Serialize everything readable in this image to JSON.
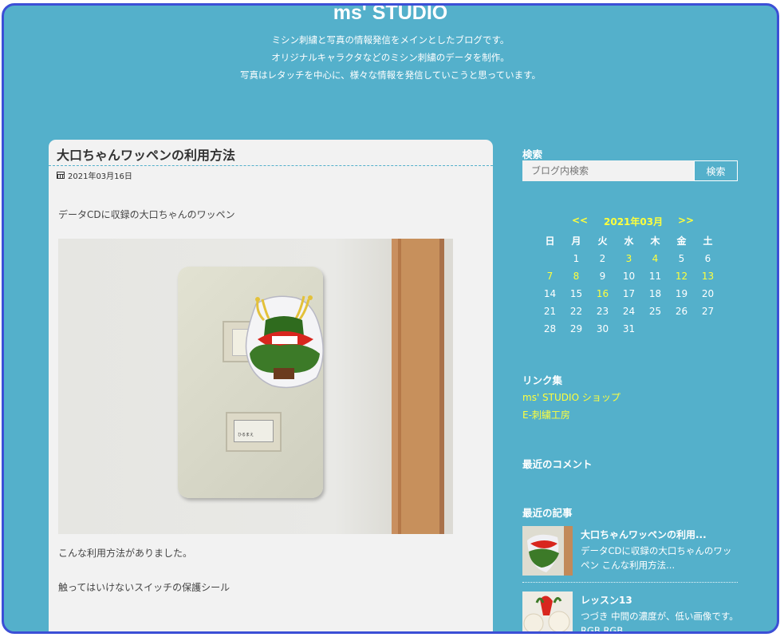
{
  "site": {
    "title": "ms' STUDIO",
    "tagline": [
      "ミシン刺繍と写真の情報発信をメインとしたブログです。",
      "オリジナルキャラクタなどのミシン刺繍のデータを制作。",
      "写真はレタッチを中心に、様々な情報を発信していこうと思っています。"
    ]
  },
  "post": {
    "title": "大口ちゃんワッペンの利用方法",
    "date": "2021年03月16日",
    "paragraphs": [
      "データCDに収録の大口ちゃんのワッペン",
      "こんな利用方法がありました。",
      "触ってはいけないスイッチの保護シール"
    ],
    "switch_label": "ひるまえ"
  },
  "sidebar": {
    "search": {
      "heading": "検索",
      "placeholder": "ブログ内検索",
      "button": "検索"
    },
    "calendar": {
      "prev": "<<",
      "month": "2021年03月",
      "next": ">>",
      "weekdays": [
        "日",
        "月",
        "火",
        "水",
        "木",
        "金",
        "土"
      ],
      "weeks": [
        [
          "",
          "1",
          "2",
          "3",
          "4",
          "5",
          "6"
        ],
        [
          "7",
          "8",
          "9",
          "10",
          "11",
          "12",
          "13"
        ],
        [
          "14",
          "15",
          "16",
          "17",
          "18",
          "19",
          "20"
        ],
        [
          "21",
          "22",
          "23",
          "24",
          "25",
          "26",
          "27"
        ],
        [
          "28",
          "29",
          "30",
          "31",
          "",
          "",
          ""
        ]
      ],
      "linked_days": [
        "3",
        "4",
        "7",
        "8",
        "12",
        "13",
        "16"
      ],
      "link_color": "#ffff3c"
    },
    "links": {
      "heading": "リンク集",
      "items": [
        "ms' STUDIO ショップ",
        "E-刺繍工房"
      ]
    },
    "comments": {
      "heading": "最近のコメント"
    },
    "recent": {
      "heading": "最近の記事",
      "items": [
        {
          "title": "大口ちゃんワッペンの利用...",
          "excerpt": "データCDに収録の大口ちゃんのワッペン こんな利用方法..."
        },
        {
          "title": "レッスン13",
          "excerpt": "つづき 中間の濃度が、低い画像です。 RGB RGB..."
        }
      ]
    }
  },
  "colors": {
    "background": "#54b0cb",
    "frame_border": "#3c4fd6",
    "accent": "#ffff3c",
    "card": "#f2f2f2"
  }
}
